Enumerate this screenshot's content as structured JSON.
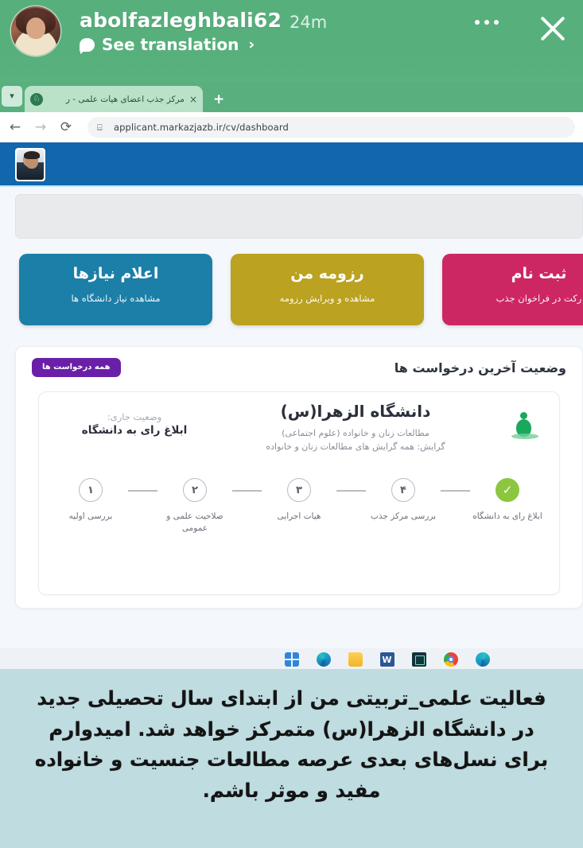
{
  "story": {
    "username": "abolfazleghbali62",
    "time_ago": "24m",
    "translate_label": "See translation",
    "translate_chevron": "›",
    "more_label": "More options",
    "close_label": "Close"
  },
  "browser": {
    "tab": {
      "title": "مرکز جذب اعضای هیأت علمی - ر",
      "close": "×",
      "new_tab": "+",
      "tab_list": "▾"
    },
    "toolbar": {
      "back": "←",
      "forward": "→",
      "reload": "⟳",
      "site_info": "⌸",
      "url": "applicant.markazjazb.ir/cv/dashboard"
    }
  },
  "site": {
    "cards": [
      {
        "id": "needs",
        "title": "اعلام نیازها",
        "subtitle": "مشاهده نیاز دانشگاه ها",
        "color": "#1c7fa8"
      },
      {
        "id": "resume",
        "title": "رزومه من",
        "subtitle": "مشاهده و ویرایش رزومه",
        "color": "#bba220"
      },
      {
        "id": "signup",
        "title": "ثبت نام",
        "subtitle": "رکت در فراخوان جذب",
        "color": "#cd2763"
      }
    ],
    "panel": {
      "title": "وضعیت آخرین درخواست ها",
      "all_requests_button": "همه درخواست ها",
      "request": {
        "university": "دانشگاه الزهرا(س)",
        "field": "مطالعات زنان و خانواده (علوم اجتماعی)",
        "specialty": "گرایش: همه گرایش های مطالعات زنان و خانواده",
        "status_label": "وضعیت جاری:",
        "status_value": "ابلاغ رای به دانشگاه"
      },
      "steps": [
        {
          "marker": "۱",
          "label": "بررسی اولیه",
          "done": false
        },
        {
          "marker": "۲",
          "label": "صلاحیت علمی و عمومی",
          "done": false
        },
        {
          "marker": "۳",
          "label": "هیات اجرایی",
          "done": false
        },
        {
          "marker": "۴",
          "label": "بررسی مرکز جذب",
          "done": false
        },
        {
          "marker": "✓",
          "label": "ابلاغ رای به دانشگاه",
          "done": true
        }
      ]
    }
  },
  "taskbar": {
    "items": [
      "start-icon",
      "edge-icon",
      "file-explorer-icon",
      "word-icon",
      "terminal-icon",
      "chrome-icon",
      "edge-icon"
    ],
    "word_glyph": "W"
  },
  "caption": {
    "text": "فعالیت علمی_تربیتی من از ابتدای سال تحصیلی جدید در دانشگاه الزهرا(س) متمرکز خواهد شد. امیدوارم برای نسل‌های بعدی عرصه مطالعات جنسیت و خانواده مفید و موثر باشم."
  }
}
